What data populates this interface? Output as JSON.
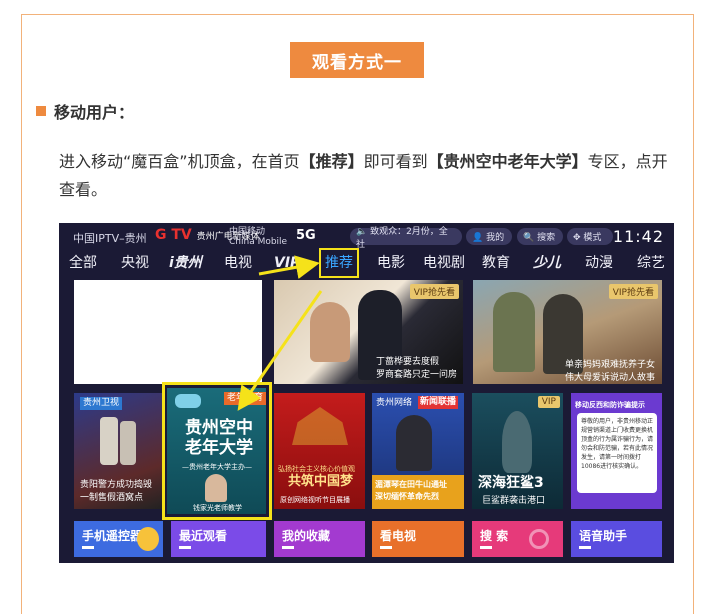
{
  "section_badge": "观看方式一",
  "sub_heading": "移动用户：",
  "paragraph": {
    "pre": "进入移动“魔百盒”机顶盒，在首页",
    "tab": "【推荐】",
    "mid": "即可看到",
    "zone": "【贵州空中老年大学】",
    "post": "专区，点开查看。"
  },
  "tv": {
    "status": {
      "brand": "中国IPTV–贵州",
      "gtv": "G TV",
      "gtv_sub": "贵州广电新媒体",
      "china_mobile": "中国移动\nChina Mobile",
      "fiveg": "5G",
      "notice": "🔈 致观众：2月份，全社",
      "mine": "👤 我的",
      "search": "🔍 搜索",
      "mode": "✥ 模式",
      "clock": "11:42"
    },
    "nav": [
      "全部",
      "央视",
      "i贵州",
      "电视",
      "VIP",
      "推荐",
      "电影",
      "电视剧",
      "教育",
      "少儿",
      "动漫",
      "综艺"
    ],
    "tiles": {
      "drama1_vip": "VIP抢先看",
      "drama1_caption": "丁蔷桦要去度假\n罗商套路只定一问房",
      "drama2_vip": "VIP抢先看",
      "drama2_caption": "单亲妈妈艰难抚养子女\n伟大母爱诉说动人故事",
      "wine_logo": "贵州卫视",
      "wine_caption": "贵阳警方成功捣毁\n一制售假酒窝点",
      "elderly_tag": "老年教育",
      "elderly_title": "贵州空中\n老年大学",
      "elderly_sub": "—贵州老年大学主办—",
      "elderly_name": "钱家光老师教学",
      "red_caption": "共筑中国梦",
      "red_sub": "弘扬社会主义核心价值观",
      "red_foot": "原创网络视听节目展播",
      "news_head": "贵州网络",
      "news_tag": "新闻联播",
      "news_caption": "湄潭琴在田牛山通址\n深切缅怀革命先烈",
      "shark_vip": "VIP",
      "shark_title": "深海狂鲨3",
      "shark_caption": "巨鲨群袭击港口",
      "notice_title": "移动反西和防诈骗提示",
      "notice_body": "尊敬的用户，非贵州移动正规营销渠道上门收费更换机顶盒的行为属诈骗行为，请勿会和防范骗，若有此情况发生，请第一时间拨打10086进行核实确认。"
    },
    "functions": [
      "手机遥控器",
      "最近观看",
      "我的收藏",
      "看电视",
      "搜 索",
      "语音助手"
    ]
  }
}
